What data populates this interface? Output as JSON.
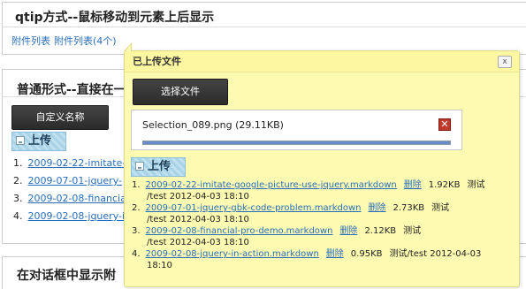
{
  "sections": {
    "qtip": {
      "title": "qtip方式--鼠标移动到元素上后显示",
      "link1": "附件列表",
      "link2": "附件列表(4个)"
    },
    "normal": {
      "title": "普通形式--直接在一",
      "custom_button": "自定义名称",
      "upload_label": "上传",
      "items": [
        {
          "num": "1.",
          "link": "2009-02-22-imitate-"
        },
        {
          "num": "2.",
          "link": "2009-07-01-jquery-"
        },
        {
          "num": "3.",
          "link": "2009-02-08-financia"
        },
        {
          "num": "4.",
          "link": "2009-02-08-jquery-i"
        }
      ]
    },
    "dialog": {
      "title": "在对话框中显示附"
    }
  },
  "tooltip": {
    "title": "已上传文件",
    "close": "x",
    "select_button": "选择文件",
    "file": {
      "name": "Selection_089.png (29.11KB)",
      "progress": 1.0,
      "remove_icon": "close-x-icon"
    },
    "upload_label": "上传",
    "files": [
      {
        "num": "1.",
        "name": "2009-02-22-imitate-google-picture-use-jquery.markdown",
        "del": "删除",
        "size": "1.92KB",
        "owner": "测试",
        "line2": "/test   2012-04-03 18:10"
      },
      {
        "num": "2.",
        "name": "2009-07-01-jquery-gbk-code-problem.markdown",
        "del": "删除",
        "size": "2.73KB",
        "owner": "测试",
        "line2": "/test   2012-04-03 18:10"
      },
      {
        "num": "3.",
        "name": "2009-02-08-financial-pro-demo.markdown",
        "del": "删除",
        "size": "2.12KB",
        "owner": "测试",
        "line2": "/test   2012-04-03 18:10"
      },
      {
        "num": "4.",
        "name": "2009-02-08-jquery-in-action.markdown",
        "del": "删除",
        "size": "0.95KB",
        "owner": "测试/test   2012-04-03",
        "line2": "18:10"
      }
    ]
  },
  "colors": {
    "tooltip_bg": "#fdfbb2",
    "link": "#2a6ebb",
    "remove": "#c0392b"
  }
}
